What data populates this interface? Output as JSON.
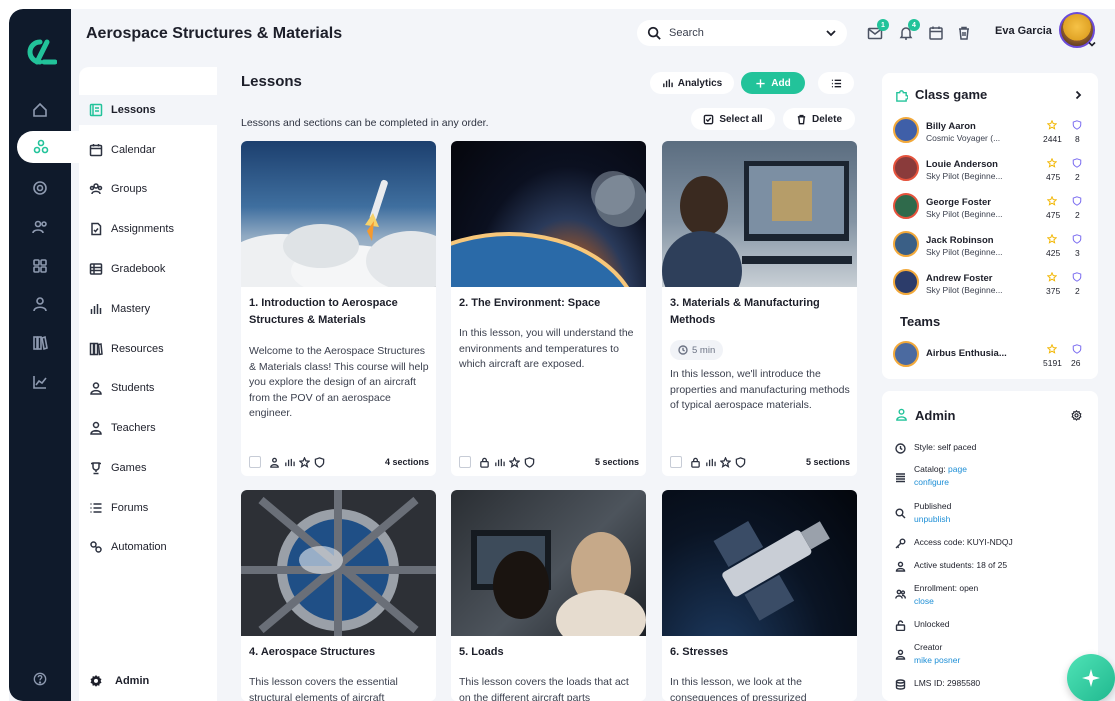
{
  "header": {
    "title": "Aerospace Structures & Materials",
    "search_placeholder": "Search",
    "mail_badge": "1",
    "bell_badge": "4",
    "user_name": "Eva Garcia"
  },
  "sidebar": {
    "items": [
      {
        "label": "Lessons",
        "icon": "lessons-icon"
      },
      {
        "label": "Calendar",
        "icon": "calendar-icon"
      },
      {
        "label": "Groups",
        "icon": "groups-icon"
      },
      {
        "label": "Assignments",
        "icon": "assignments-icon"
      },
      {
        "label": "Gradebook",
        "icon": "gradebook-icon"
      },
      {
        "label": "Mastery",
        "icon": "mastery-icon"
      },
      {
        "label": "Resources",
        "icon": "resources-icon"
      },
      {
        "label": "Students",
        "icon": "students-icon"
      },
      {
        "label": "Teachers",
        "icon": "teachers-icon"
      },
      {
        "label": "Games",
        "icon": "games-icon"
      },
      {
        "label": "Forums",
        "icon": "forums-icon"
      },
      {
        "label": "Automation",
        "icon": "automation-icon"
      }
    ],
    "admin_label": "Admin"
  },
  "lessons": {
    "heading": "Lessons",
    "analytics_label": "Analytics",
    "add_label": "Add",
    "select_all_label": "Select all",
    "delete_label": "Delete",
    "subtitle": "Lessons and sections can be completed in any order.",
    "cards": [
      {
        "title": "1. Introduction to Aerospace Structures & Materials",
        "desc": "Welcome to the Aerospace Structures & Materials class! This course will help you explore the design of an aircraft from the POV of an aerospace engineer.",
        "sections": "4 sections"
      },
      {
        "title": "2. The Environment: Space",
        "desc": "In this lesson, you will understand the environments and temperatures to which aircraft are exposed.",
        "sections": "5 sections"
      },
      {
        "title": "3. Materials & Manufacturing Methods",
        "duration": "5 min",
        "desc": "In this lesson, we'll introduce the properties and manufacturing methods of typical aerospace materials.",
        "sections": "5 sections"
      },
      {
        "title": "4. Aerospace Structures",
        "desc": "This lesson covers the essential structural elements of aircraft"
      },
      {
        "title": "5. Loads",
        "desc": "This lesson covers the loads that act on the different aircraft parts"
      },
      {
        "title": "6. Stresses",
        "desc": "In this lesson, we look at the consequences of pressurized"
      }
    ]
  },
  "class_game": {
    "title": "Class game",
    "players": [
      {
        "name": "Billy Aaron",
        "rank": "Cosmic Voyager (...",
        "points": "2441",
        "badges": "8"
      },
      {
        "name": "Louie Anderson",
        "rank": "Sky Pilot (Beginne...",
        "points": "475",
        "badges": "2"
      },
      {
        "name": "George Foster",
        "rank": "Sky Pilot (Beginne...",
        "points": "475",
        "badges": "2"
      },
      {
        "name": "Jack Robinson",
        "rank": "Sky Pilot (Beginne...",
        "points": "425",
        "badges": "3"
      },
      {
        "name": "Andrew Foster",
        "rank": "Sky Pilot (Beginne...",
        "points": "375",
        "badges": "2"
      }
    ],
    "teams_label": "Teams",
    "teams": [
      {
        "name": "Airbus Enthusia...",
        "points": "5191",
        "badges": "26"
      }
    ]
  },
  "admin_panel": {
    "title": "Admin",
    "style": "Style: self paced",
    "catalog_label": "Catalog:",
    "catalog_link1": "page",
    "catalog_link2": "configure",
    "published_label": "Published",
    "published_link": "unpublish",
    "access_code": "Access code: KUYI-NDQJ",
    "active_students": "Active students: 18 of 25",
    "enrollment_label": "Enrollment: open",
    "enrollment_link": "close",
    "unlocked": "Unlocked",
    "creator_label": "Creator",
    "creator_link": "mike posner",
    "lms_id": "LMS ID: 2985580"
  },
  "colors": {
    "accent": "#22c39a",
    "rail": "#0f1a2b",
    "link": "#1e8fd6",
    "star": "#f2b705",
    "shield": "#7a6cf0"
  }
}
